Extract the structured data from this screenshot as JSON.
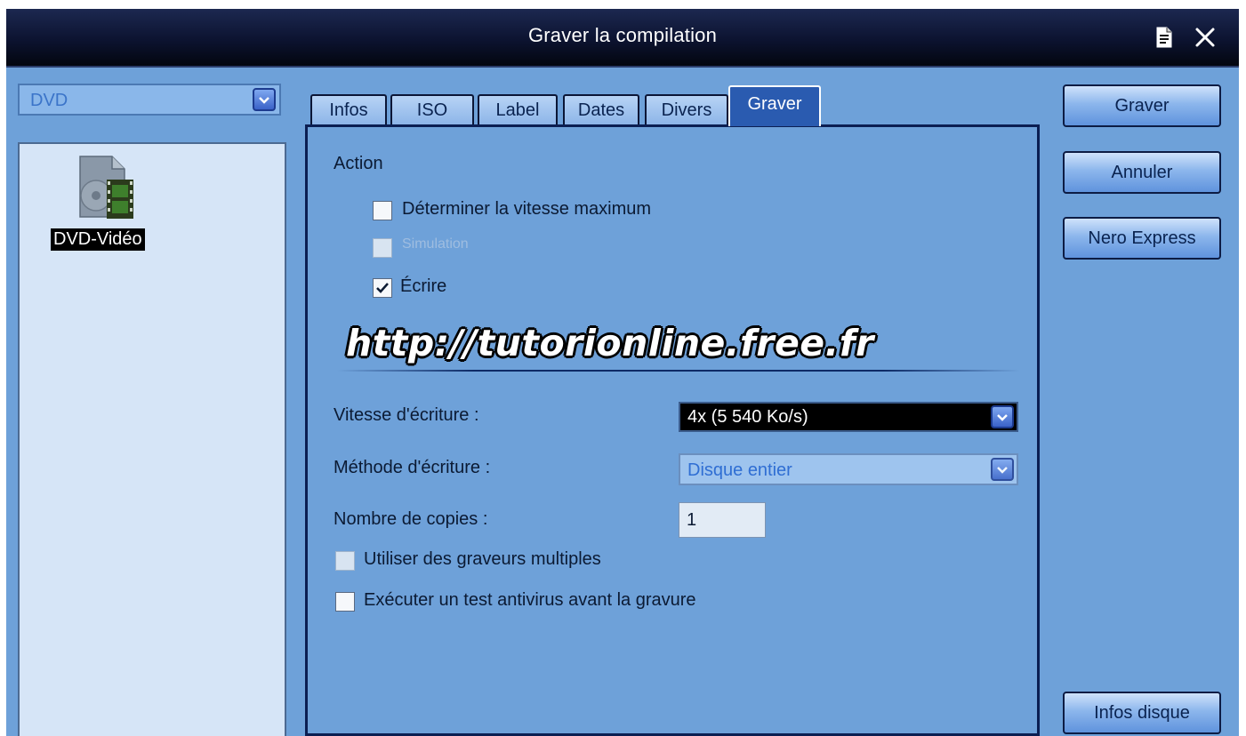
{
  "window": {
    "title": "Graver la compilation",
    "icons": {
      "help": "document-icon",
      "close": "close-icon"
    }
  },
  "left_panel": {
    "compilation_select": {
      "value": "DVD"
    },
    "items": [
      {
        "label": "DVD-Vidéo",
        "icon": "dvd-video-icon",
        "selected": true
      }
    ]
  },
  "tabs": [
    {
      "label": "Infos",
      "active": false
    },
    {
      "label": "ISO",
      "active": false
    },
    {
      "label": "Label",
      "active": false
    },
    {
      "label": "Dates",
      "active": false
    },
    {
      "label": "Divers",
      "active": false
    },
    {
      "label": "Graver",
      "active": true
    }
  ],
  "burn_tab": {
    "action_heading": "Action",
    "options": [
      {
        "label": "Déterminer la vitesse maximum",
        "checked": false,
        "enabled": true
      },
      {
        "label": "Simulation",
        "checked": false,
        "enabled": false
      },
      {
        "label": "Écrire",
        "checked": true,
        "enabled": true
      }
    ],
    "watermark": "http://tutorionline.free.fr",
    "write_speed": {
      "label": "Vitesse d'écriture :",
      "value": "4x (5 540 Ko/s)"
    },
    "write_method": {
      "label": "Méthode d'écriture :",
      "value": "Disque entier",
      "enabled": false
    },
    "copies": {
      "label": "Nombre de copies :",
      "value": "1"
    },
    "extra_options": [
      {
        "label": "Utiliser des graveurs multiples",
        "checked": false
      },
      {
        "label": "Exécuter un test antivirus avant la gravure",
        "checked": false
      }
    ]
  },
  "buttons": {
    "burn": "Graver",
    "cancel": "Annuler",
    "nero_express": "Nero Express",
    "disc_info": "Infos disque"
  },
  "colors": {
    "window_bg": "#6ea1d9",
    "titlebar": "#0c1330",
    "active_tab": "#2a5bb0",
    "panel_border": "#0b1e52"
  }
}
